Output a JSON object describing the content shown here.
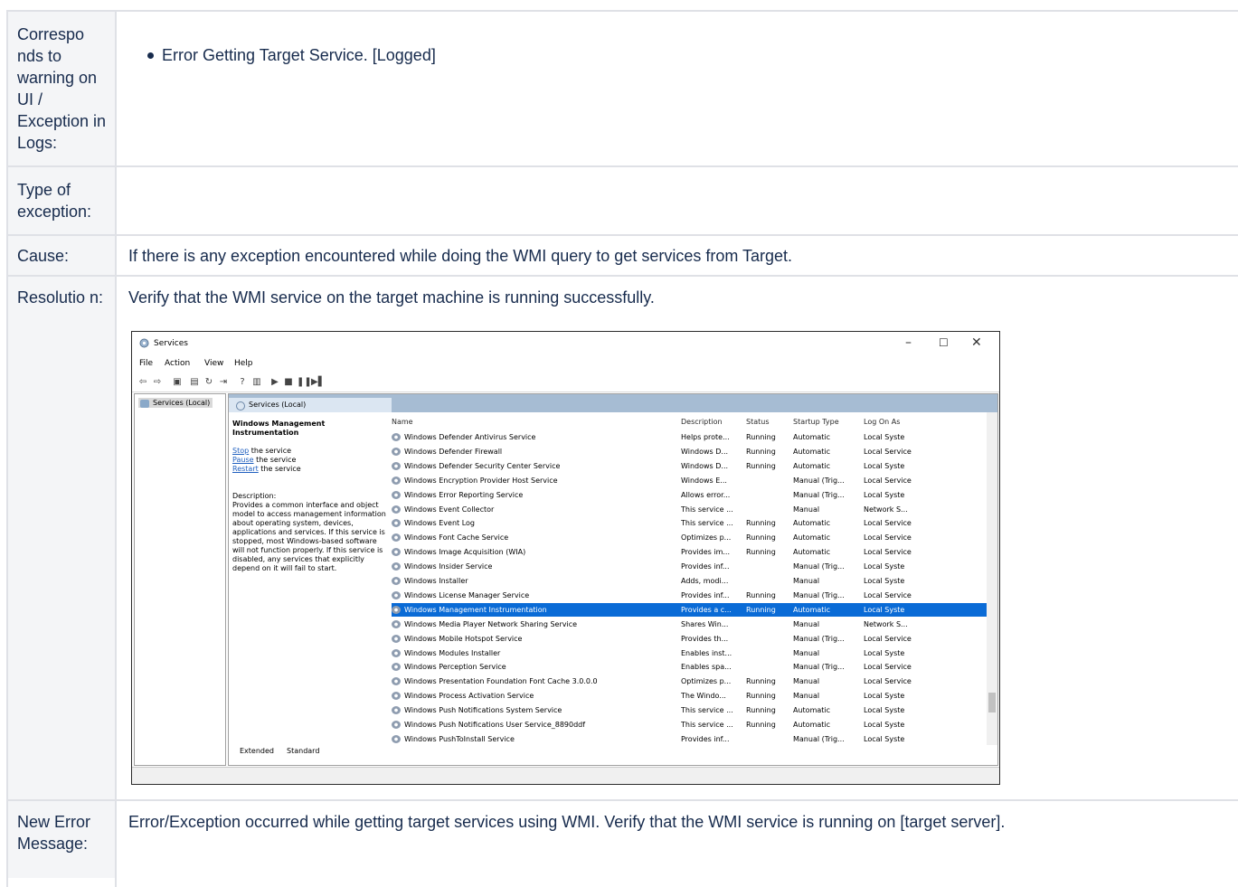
{
  "rows": [
    {
      "label": "Correspo nds to warning on UI / Exception in Logs:",
      "bullets": [
        "Error Getting Target Service. [Logged]"
      ]
    },
    {
      "label": "Type of exception:",
      "value": ""
    },
    {
      "label": "Cause:",
      "value": "If there is any exception encountered while doing the WMI query to get services from Target."
    },
    {
      "label": "Resolutio n:",
      "value": "Verify that the WMI service on the target machine is running successfully."
    },
    {
      "label": "New Error Message:",
      "value": "Error/Exception occurred while getting target services using WMI. Verify that the WMI service is running on [target server]."
    }
  ],
  "screenshot": {
    "title": "Services",
    "window_controls": [
      "–",
      "☐",
      "✕"
    ],
    "menu": [
      "File",
      "Action",
      "View",
      "Help"
    ],
    "tree_item": "Services (Local)",
    "panel_header": "Services (Local)",
    "details": {
      "name": "Windows Management Instrumentation",
      "stop_link": "Stop",
      "stop_rest": " the service",
      "pause_link": "Pause",
      "pause_rest": " the service",
      "restart_link": "Restart",
      "restart_rest": " the service",
      "description_label": "Description:",
      "description": "Provides a common interface and object model to access management information about operating system, devices, applications and services. If this service is stopped, most Windows-based software will not function properly. If this service is disabled, any services that explicitly depend on it will fail to start."
    },
    "columns": [
      "Name",
      "Description",
      "Status",
      "Startup Type",
      "Log On As"
    ],
    "services": [
      [
        "Windows Defender Antivirus Service",
        "Helps prote...",
        "Running",
        "Automatic",
        "Local Syste"
      ],
      [
        "Windows Defender Firewall",
        "Windows D...",
        "Running",
        "Automatic",
        "Local Service"
      ],
      [
        "Windows Defender Security Center Service",
        "Windows D...",
        "Running",
        "Automatic",
        "Local Syste"
      ],
      [
        "Windows Encryption Provider Host Service",
        "Windows E...",
        "",
        "Manual (Trig...",
        "Local Service"
      ],
      [
        "Windows Error Reporting Service",
        "Allows error...",
        "",
        "Manual (Trig...",
        "Local Syste"
      ],
      [
        "Windows Event Collector",
        "This service ...",
        "",
        "Manual",
        "Network S..."
      ],
      [
        "Windows Event Log",
        "This service ...",
        "Running",
        "Automatic",
        "Local Service"
      ],
      [
        "Windows Font Cache Service",
        "Optimizes p...",
        "Running",
        "Automatic",
        "Local Service"
      ],
      [
        "Windows Image Acquisition (WIA)",
        "Provides im...",
        "Running",
        "Automatic",
        "Local Service"
      ],
      [
        "Windows Insider Service",
        "Provides inf...",
        "",
        "Manual (Trig...",
        "Local Syste"
      ],
      [
        "Windows Installer",
        "Adds, modi...",
        "",
        "Manual",
        "Local Syste"
      ],
      [
        "Windows License Manager Service",
        "Provides inf...",
        "Running",
        "Manual (Trig...",
        "Local Service"
      ],
      [
        "Windows Management Instrumentation",
        "Provides a c...",
        "Running",
        "Automatic",
        "Local Syste"
      ],
      [
        "Windows Media Player Network Sharing Service",
        "Shares Win...",
        "",
        "Manual",
        "Network S..."
      ],
      [
        "Windows Mobile Hotspot Service",
        "Provides th...",
        "",
        "Manual (Trig...",
        "Local Service"
      ],
      [
        "Windows Modules Installer",
        "Enables inst...",
        "",
        "Manual",
        "Local Syste"
      ],
      [
        "Windows Perception Service",
        "Enables spa...",
        "",
        "Manual (Trig...",
        "Local Service"
      ],
      [
        "Windows Presentation Foundation Font Cache 3.0.0.0",
        "Optimizes p...",
        "Running",
        "Manual",
        "Local Service"
      ],
      [
        "Windows Process Activation Service",
        "The Windo...",
        "Running",
        "Manual",
        "Local Syste"
      ],
      [
        "Windows Push Notifications System Service",
        "This service ...",
        "Running",
        "Automatic",
        "Local Syste"
      ],
      [
        "Windows Push Notifications User Service_8890ddf",
        "This service ...",
        "Running",
        "Automatic",
        "Local Syste"
      ],
      [
        "Windows PushToInstall Service",
        "Provides inf...",
        "",
        "Manual (Trig...",
        "Local Syste"
      ]
    ],
    "selected_service": "Windows Management Instrumentation",
    "bottom_tabs": [
      "Extended",
      "Standard"
    ]
  }
}
